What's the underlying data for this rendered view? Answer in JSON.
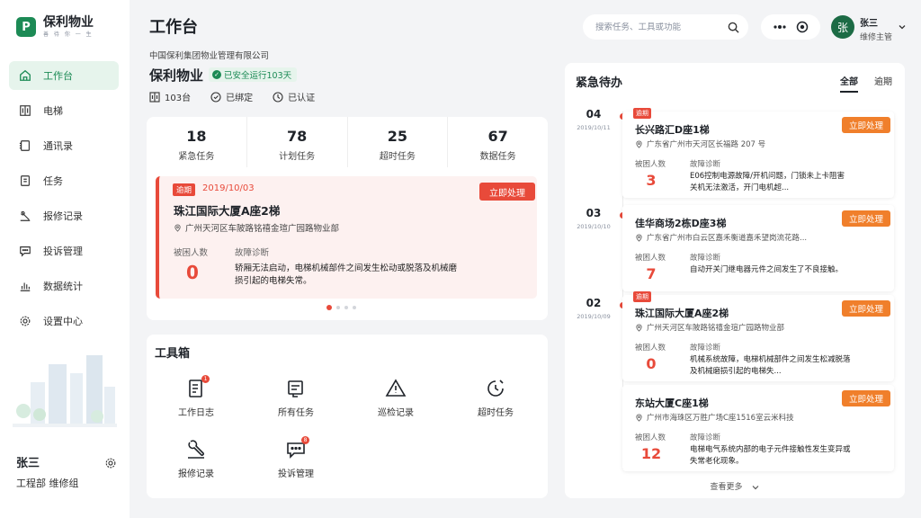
{
  "brand": {
    "name": "保利物业",
    "slogan": "善 待 你 一 生"
  },
  "nav": [
    {
      "label": "工作台",
      "icon": "home-icon",
      "active": true
    },
    {
      "label": "电梯",
      "icon": "elevator-icon",
      "active": false
    },
    {
      "label": "通讯录",
      "icon": "contacts-icon",
      "active": false
    },
    {
      "label": "任务",
      "icon": "task-icon",
      "active": false
    },
    {
      "label": "报修记录",
      "icon": "repair-icon",
      "active": false
    },
    {
      "label": "投诉管理",
      "icon": "complaint-icon",
      "active": false
    },
    {
      "label": "数据统计",
      "icon": "chart-icon",
      "active": false
    },
    {
      "label": "设置中心",
      "icon": "gear-icon",
      "active": false
    }
  ],
  "sidebar_user": {
    "name": "张三",
    "dept": "工程部 维修组"
  },
  "header": {
    "title": "工作台",
    "search_placeholder": "搜索任务、工具或功能",
    "user_name": "张三",
    "user_role": "维修主管",
    "avatar_text": "张"
  },
  "company": {
    "full_name": "中国保利集团物业管理有限公司",
    "name": "保利物业",
    "safe_badge": "已安全运行103天",
    "meta": [
      {
        "icon": "elevator-icon",
        "text": "103台"
      },
      {
        "icon": "link-icon",
        "text": "已绑定"
      },
      {
        "icon": "verified-icon",
        "text": "已认证"
      }
    ]
  },
  "stats": [
    {
      "value": "18",
      "label": "紧急任务"
    },
    {
      "value": "78",
      "label": "计划任务"
    },
    {
      "value": "25",
      "label": "超时任务"
    },
    {
      "value": "67",
      "label": "数据任务"
    }
  ],
  "featured": {
    "tag": "逾期",
    "date": "2019/10/03",
    "title": "珠江国际大厦A座2梯",
    "address": "广州天河区车陂路铭禧金瑄广园路物业部",
    "button": "立即处理",
    "trapped_label": "被困人数",
    "trapped": "0",
    "diag_label": "故障诊断",
    "diag": "轿厢无法启动，电梯机械部件之间发生松动或脱落及机械磨损引起的电梯失常。"
  },
  "toolbox": {
    "title": "工具箱",
    "tools": [
      {
        "label": "工作日志",
        "icon": "log-icon",
        "badge": "1"
      },
      {
        "label": "所有任务",
        "icon": "tasks-icon",
        "badge": ""
      },
      {
        "label": "巡检记录",
        "icon": "warning-icon",
        "badge": ""
      },
      {
        "label": "超时任务",
        "icon": "clock-icon",
        "badge": ""
      },
      {
        "label": "报修记录",
        "icon": "wrench-icon",
        "badge": ""
      },
      {
        "label": "投诉管理",
        "icon": "message-icon",
        "badge": "8"
      }
    ]
  },
  "emergency": {
    "title": "紧急待办",
    "tabs": [
      "全部",
      "逾期"
    ],
    "more": "查看更多",
    "groups": [
      {
        "day": "04",
        "date": "2019/10/11"
      },
      {
        "day": "03",
        "date": "2019/10/10"
      },
      {
        "day": "02",
        "date": "2019/10/09"
      }
    ],
    "items": [
      {
        "tag": "逾期",
        "title": "长兴路汇D座1梯",
        "address": "广东省广州市天河区长福路 207 号",
        "button": "立即处理",
        "trapped_label": "被困人数",
        "trapped": "3",
        "diag_label": "故障诊断",
        "diag": "E06控制电源故障/开机问题，门锁未上卡阻害关机无法激活，开门电机超..."
      },
      {
        "tag": "",
        "title": "佳华商场2栋D座3梯",
        "address": "广东省广州市白云区嘉禾衡道嘉禾望岗流花路...",
        "button": "立即处理",
        "trapped_label": "被困人数",
        "trapped": "7",
        "diag_label": "故障诊断",
        "diag": "自动开关门继电器元件之间发生了不良接触。"
      },
      {
        "tag": "逾期",
        "title": "珠江国际大厦A座2梯",
        "address": "广州天河区车陂路铭禧金瑄广园路物业部",
        "button": "立即处理",
        "trapped_label": "被困人数",
        "trapped": "0",
        "diag_label": "故障诊断",
        "diag": "机械系统故障，电梯机械部件之间发生松减脱落及机械磨损引起的电梯失..."
      },
      {
        "tag": "",
        "title": "东站大厦C座1梯",
        "address": "广州市海珠区万胜广场C座1516室云米科技",
        "button": "立即处理",
        "trapped_label": "被困人数",
        "trapped": "12",
        "diag_label": "故障诊断",
        "diag": "电梯电气系统内部的电子元件接触性发生变异或失常老化现象。"
      }
    ]
  },
  "colors": {
    "brand": "#1c8a55",
    "danger": "#e84a3a",
    "action": "#f07f2b"
  }
}
